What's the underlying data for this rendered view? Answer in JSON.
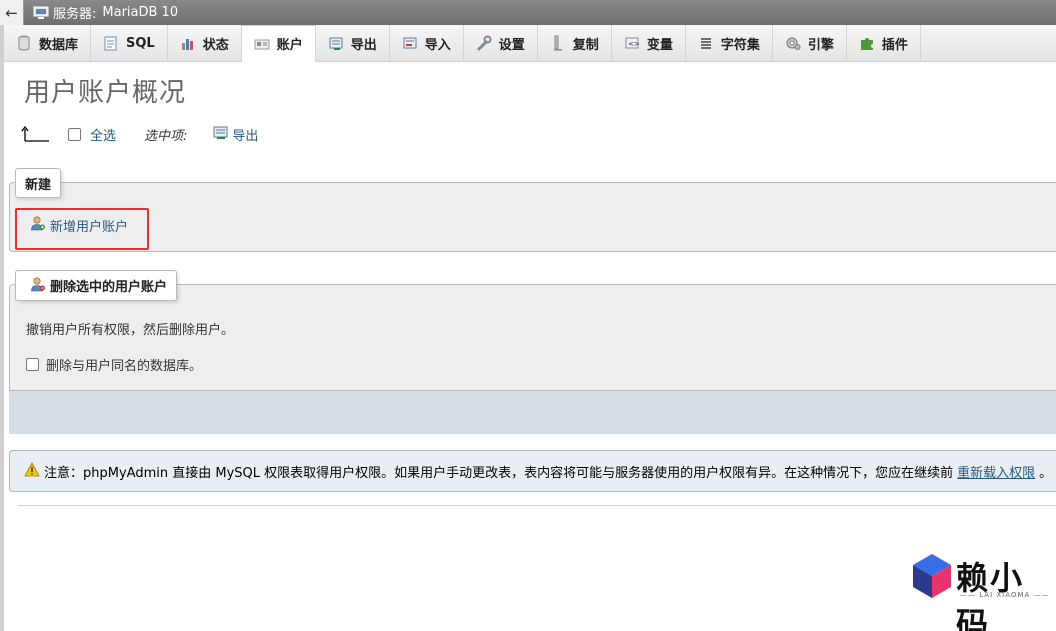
{
  "server_bar": {
    "back_icon": "←",
    "label": "服务器:",
    "server_name": "MariaDB 10"
  },
  "tabs": [
    {
      "label": "数据库",
      "icon": "database-icon"
    },
    {
      "label": "SQL",
      "icon": "sql-icon"
    },
    {
      "label": "状态",
      "icon": "status-icon"
    },
    {
      "label": "账户",
      "icon": "accounts-icon",
      "active": true
    },
    {
      "label": "导出",
      "icon": "export-icon"
    },
    {
      "label": "导入",
      "icon": "import-icon"
    },
    {
      "label": "设置",
      "icon": "settings-icon"
    },
    {
      "label": "复制",
      "icon": "replication-icon"
    },
    {
      "label": "变量",
      "icon": "variables-icon"
    },
    {
      "label": "字符集",
      "icon": "charset-icon"
    },
    {
      "label": "引擎",
      "icon": "engine-icon"
    },
    {
      "label": "插件",
      "icon": "plugin-icon"
    }
  ],
  "page_title": "用户账户概况",
  "selection": {
    "select_all_label": "全选",
    "selected_label": "选中项:",
    "export_label": "导出"
  },
  "new_section": {
    "legend": "新建",
    "add_user_label": "新增用户账户"
  },
  "delete_section": {
    "legend": "删除选中的用户账户",
    "revoke_text": "撤销用户所有权限，然后删除用户。",
    "drop_db_label": "删除与用户同名的数据库。"
  },
  "notice": {
    "text": "注意：phpMyAdmin 直接由 MySQL 权限表取得用户权限。如果用户手动更改表，表内容将可能与服务器使用的用户权限有异。在这种情况下，您应在继续前",
    "link": "重新载入权限",
    "suffix": "。"
  },
  "watermark": {
    "title": "赖小码",
    "subtitle": "LAI XIAOMA"
  },
  "colors": {
    "link": "#235a81",
    "highlight": "#e53030",
    "fieldset_bg": "#eeeeee",
    "notice_bg": "#e8eef1"
  }
}
